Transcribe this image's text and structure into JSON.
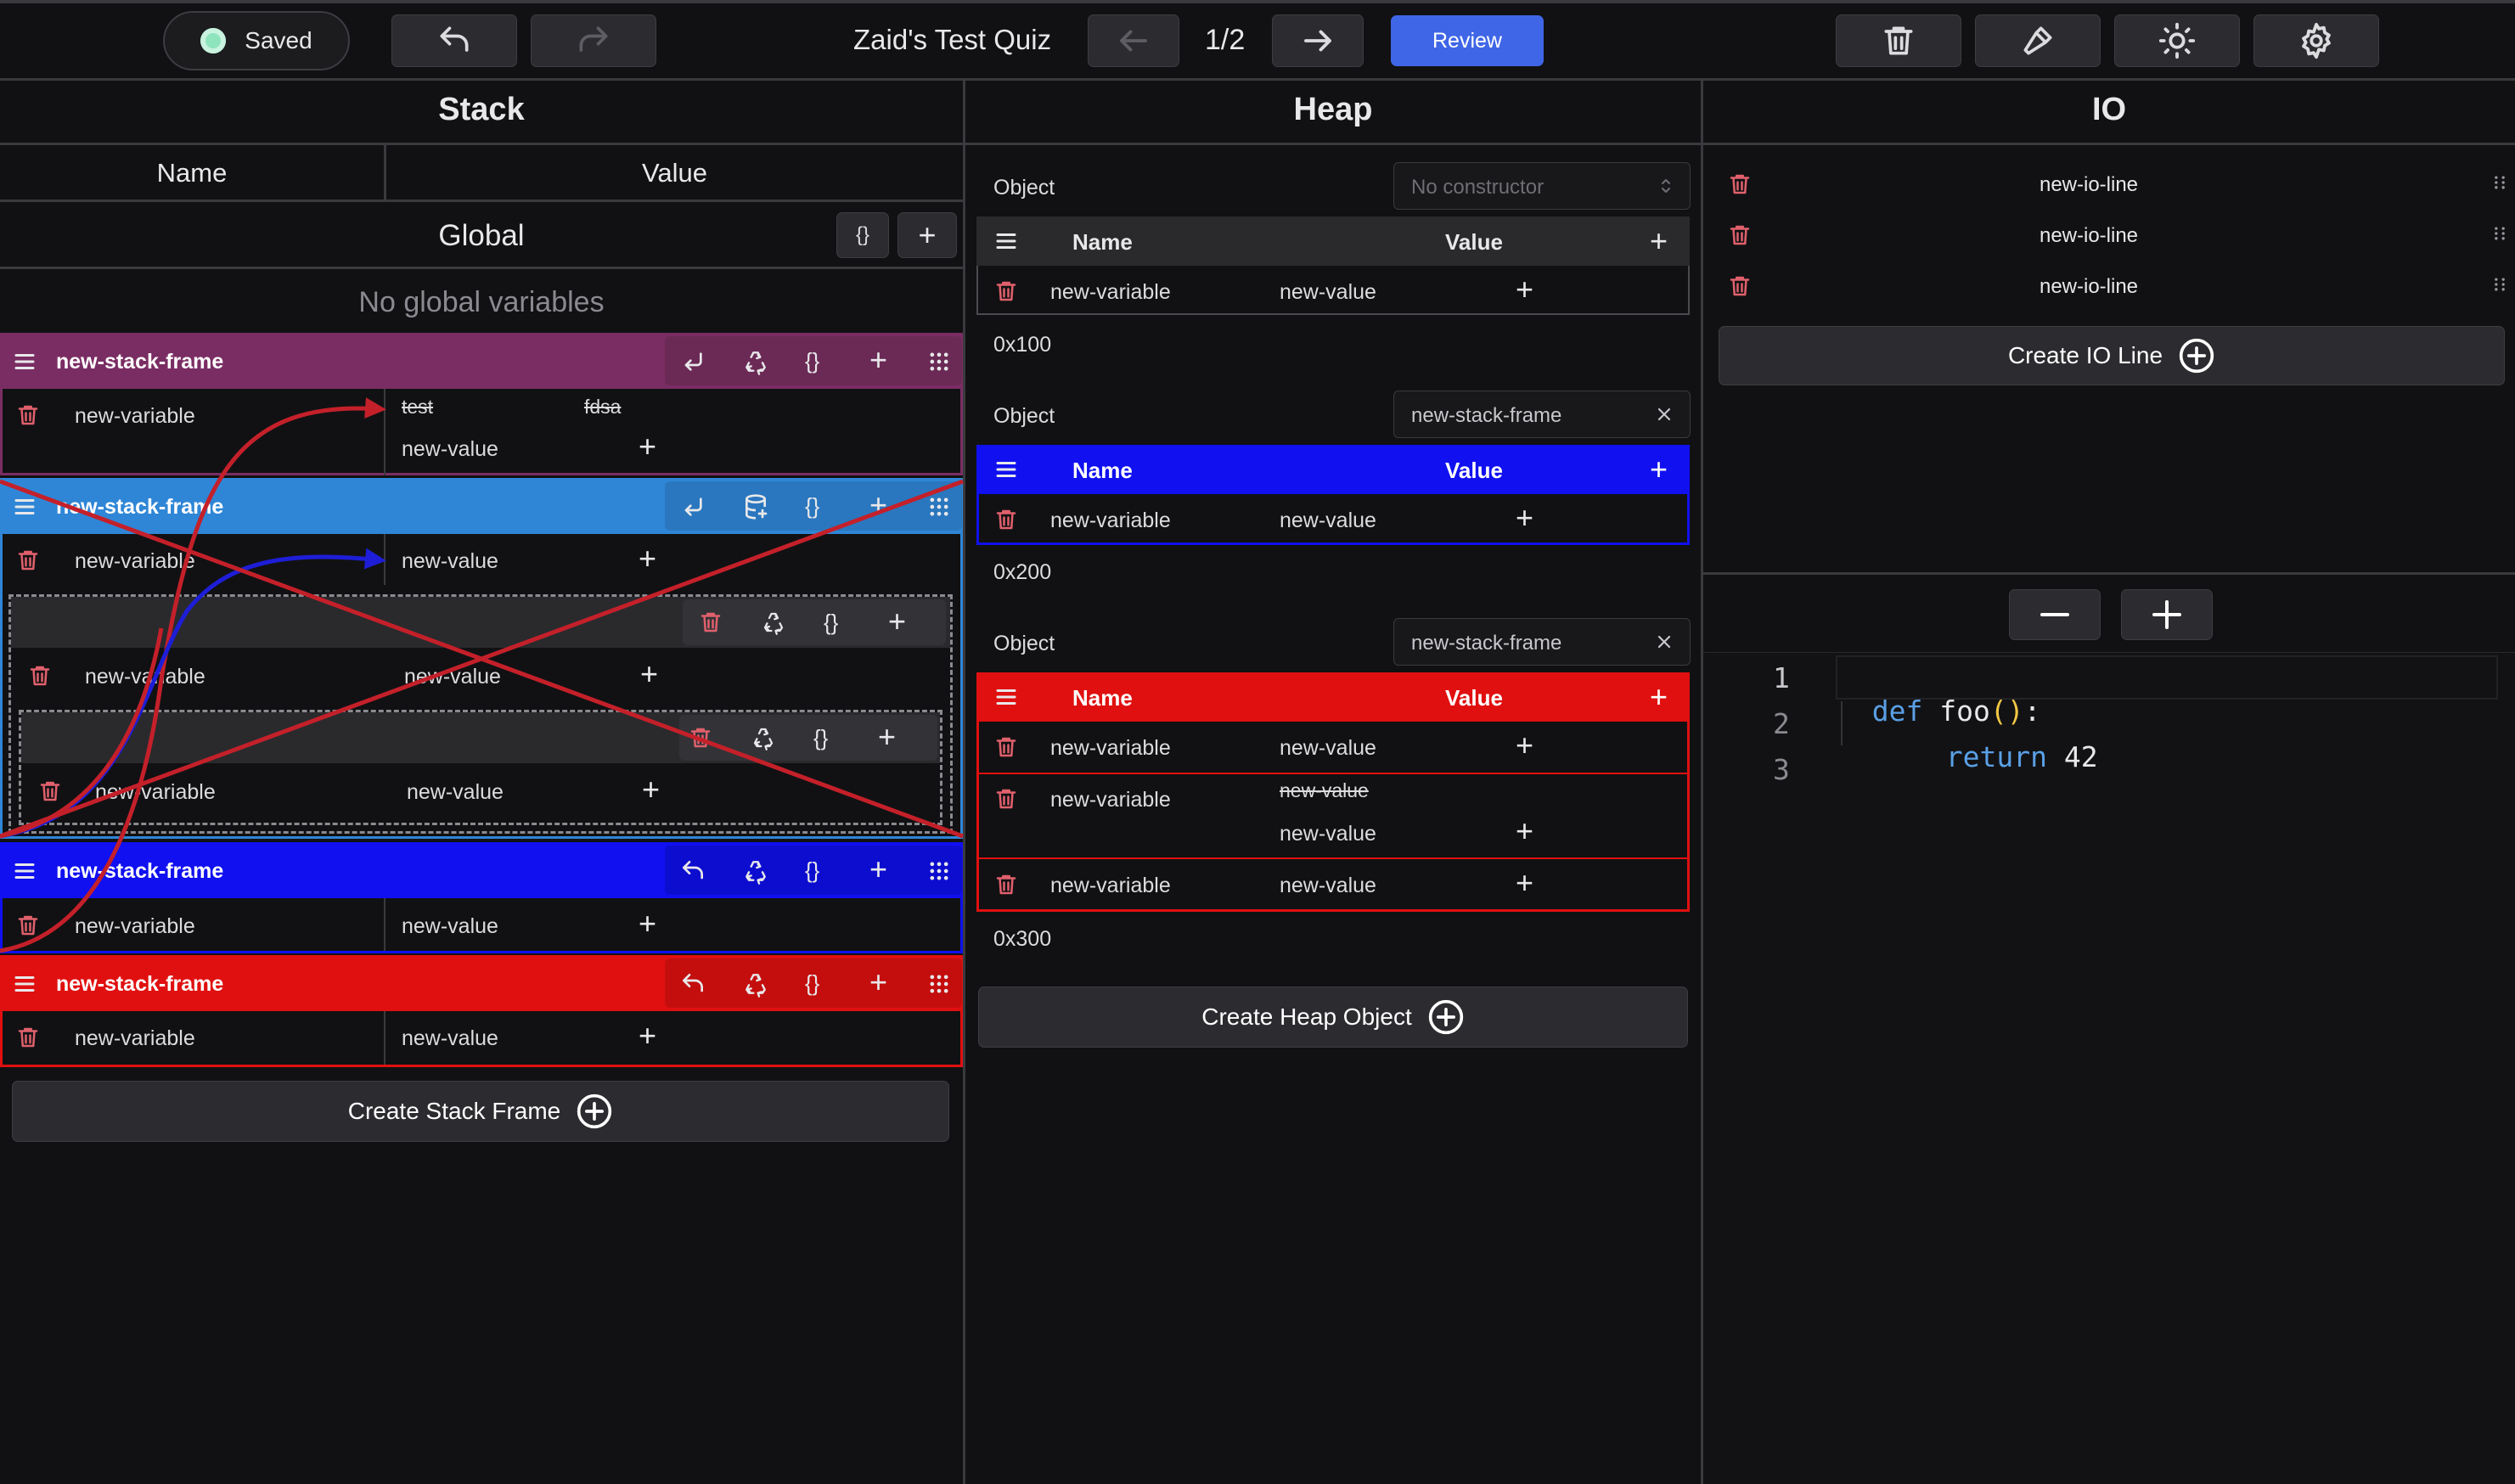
{
  "toolbar": {
    "saved_label": "Saved",
    "quiz_title": "Zaid's Test Quiz",
    "page_indicator": "1/2",
    "review_label": "Review"
  },
  "stack": {
    "title": "Stack",
    "col_name": "Name",
    "col_value": "Value",
    "global_label": "Global",
    "no_globals": "No global variables",
    "braces": "{}",
    "frames": [
      {
        "name": "new-stack-frame",
        "var": "new-variable",
        "old_values": [
          "test",
          "fdsa"
        ],
        "value": "new-value"
      },
      {
        "name": "new-stack-frame",
        "var": "new-variable",
        "value": "new-value",
        "nested": [
          {
            "var": "new-variable",
            "value": "new-value"
          },
          {
            "var": "new-variable",
            "value": "new-value"
          }
        ]
      },
      {
        "name": "new-stack-frame",
        "var": "new-variable",
        "value": "new-value"
      },
      {
        "name": "new-stack-frame",
        "var": "new-variable",
        "value": "new-value"
      }
    ],
    "create_label": "Create Stack Frame"
  },
  "heap": {
    "title": "Heap",
    "object_label": "Object",
    "col_name": "Name",
    "col_value": "Value",
    "objects": [
      {
        "constructor": "No constructor",
        "address": "0x100",
        "rows": [
          {
            "var": "new-variable",
            "value": "new-value"
          }
        ]
      },
      {
        "constructor": "new-stack-frame",
        "address": "0x200",
        "rows": [
          {
            "var": "new-variable",
            "value": "new-value"
          }
        ]
      },
      {
        "constructor": "new-stack-frame",
        "address": "0x300",
        "rows": [
          {
            "var": "new-variable",
            "value": "new-value"
          },
          {
            "var": "new-variable",
            "old_value": "new-value",
            "value": "new-value"
          },
          {
            "var": "new-variable",
            "value": "new-value"
          }
        ]
      }
    ],
    "create_label": "Create Heap Object"
  },
  "io": {
    "title": "IO",
    "lines": [
      "new-io-line",
      "new-io-line",
      "new-io-line"
    ],
    "create_label": "Create IO Line"
  },
  "code": {
    "line_numbers": [
      "1",
      "2",
      "3"
    ],
    "line1": {
      "keyword": "def",
      "name": " foo",
      "parens": "()",
      "colon": ":"
    },
    "line2": {
      "keyword": "return",
      "value": " 42"
    }
  },
  "colors": {
    "purple": "#7a2d63",
    "light_blue": "#2f86d6",
    "blue": "#1010f0",
    "red": "#e01010",
    "review": "#3f66e6"
  }
}
